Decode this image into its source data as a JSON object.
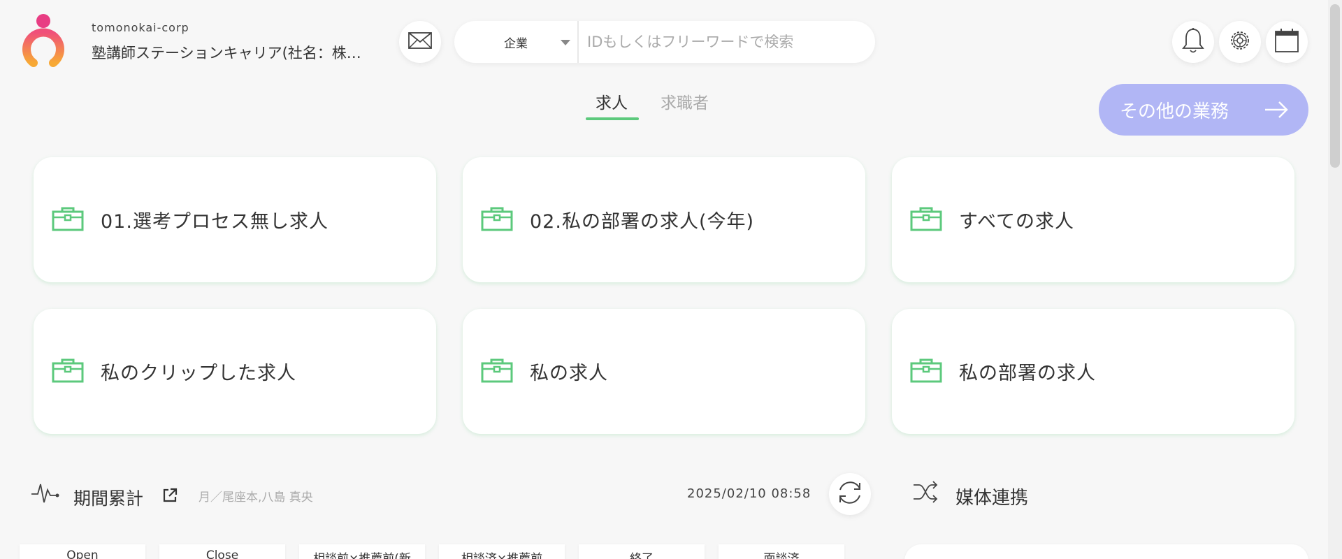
{
  "header": {
    "org_id": "tomonokai-corp",
    "org_name": "塾講師ステーションキャリア(社名：株…",
    "search": {
      "category": "企業",
      "placeholder": "IDもしくはフリーワードで検索"
    },
    "icons": [
      "logo",
      "mail-icon",
      "bell-icon",
      "gear-icon",
      "calendar-icon"
    ]
  },
  "tabs": [
    {
      "label": "求人",
      "active": true
    },
    {
      "label": "求職者",
      "active": false
    }
  ],
  "other_button": {
    "label": "その他の業務"
  },
  "cards": [
    {
      "label": "01.選考プロセス無し求人"
    },
    {
      "label": "02.私の部署の求人(今年)"
    },
    {
      "label": "すべての求人"
    },
    {
      "label": "私のクリップした求人"
    },
    {
      "label": "私の求人"
    },
    {
      "label": "私の部署の求人"
    }
  ],
  "period": {
    "title": "期間累計",
    "subtitle": "月／尾座本,八島 真央",
    "timestamp": "2025/02/10 08:58"
  },
  "media": {
    "title": "媒体連携"
  },
  "mini_tabs": [
    "Open",
    "Close",
    "相談前×推薦前(新",
    "相談済×推薦前",
    "終了",
    "面談済"
  ],
  "colors": {
    "accent_green": "#5cc97c",
    "other_button": "#b1b6f5",
    "background": "#f7f7f7"
  }
}
